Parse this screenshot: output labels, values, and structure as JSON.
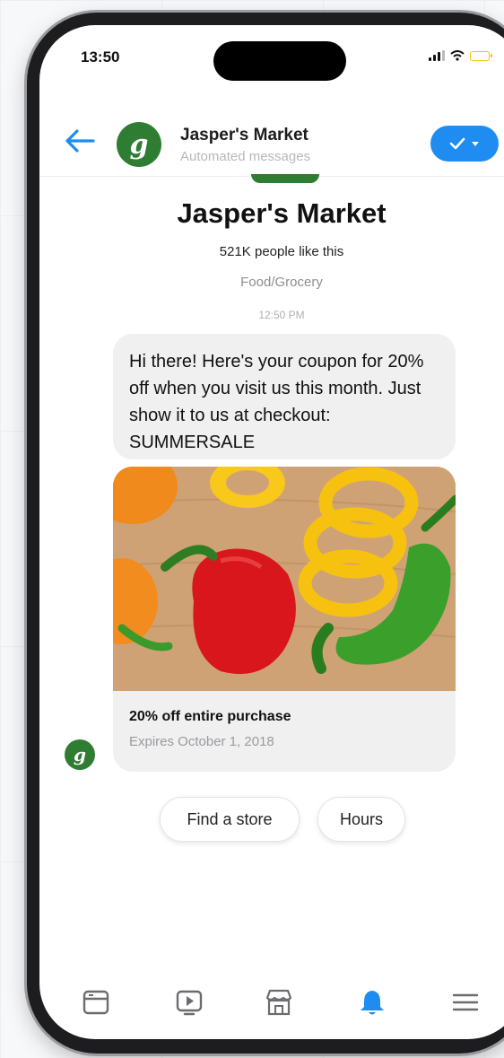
{
  "status_bar": {
    "time": "13:50"
  },
  "header": {
    "back_icon": "back-arrow-icon",
    "avatar_letter": "g",
    "name": "Jasper's Market",
    "subtitle": "Automated messages",
    "toggle_icon": "check-dropdown-icon"
  },
  "profile": {
    "name": "Jasper's Market",
    "likes": "521K people like this",
    "category": "Food/Grocery",
    "timestamp": "12:50 PM"
  },
  "message": {
    "text": "Hi there! Here's your coupon for 20% off when you visit us this month. Just show it to us at checkout: SUMMERSALE"
  },
  "card": {
    "image_description_icon": "peppers-photo",
    "title": "20% off entire purchase",
    "expiry": "Expires October 1, 2018"
  },
  "quick_replies": [
    {
      "label": "Find a store"
    },
    {
      "label": "Hours"
    }
  ],
  "tabbar": {
    "items": [
      {
        "icon": "feed-icon"
      },
      {
        "icon": "video-icon"
      },
      {
        "icon": "marketplace-icon"
      },
      {
        "icon": "bell-icon",
        "active": true
      },
      {
        "icon": "menu-icon"
      }
    ]
  },
  "colors": {
    "accent": "#1e8cf0",
    "brand_green": "#2e7d32",
    "bubble_bg": "#f0f0f0"
  }
}
